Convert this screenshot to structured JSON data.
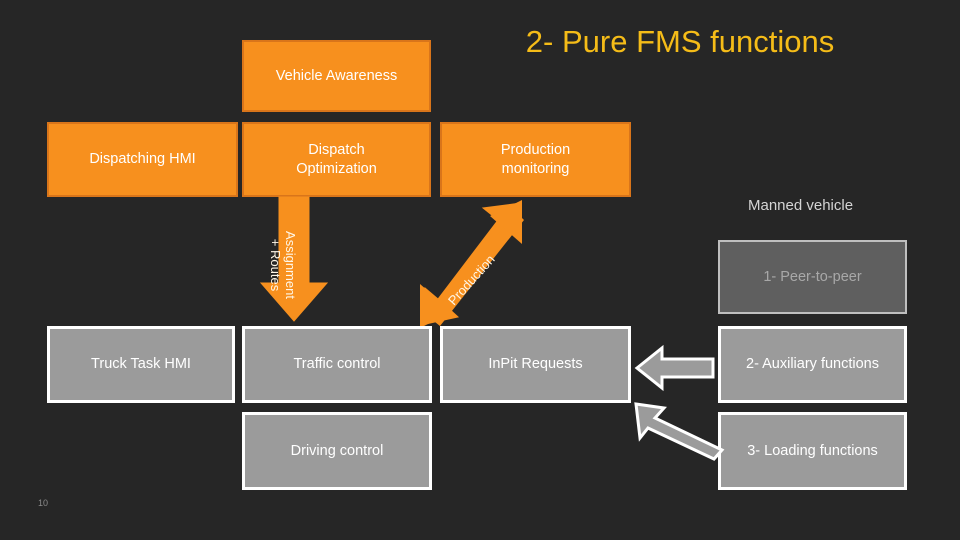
{
  "slide": {
    "title": "2- Pure FMS functions",
    "page_number": "10",
    "background_color": "#262626",
    "title_color": "#F5BC18"
  },
  "colors": {
    "fms_orange": "#F7901E",
    "fms_orange_border": "#D9751A",
    "vehicle_gray": "#9B9B9B",
    "inactive_gray": "#5F5F5F",
    "box_border_white": "#FFFFFF"
  },
  "fms_blocks": [
    {
      "id": "vehicle-awareness",
      "label": "Vehicle Awareness",
      "color": "#F7901E"
    },
    {
      "id": "dispatching-hmi",
      "label": "Dispatching HMI",
      "color": "#F7901E"
    },
    {
      "id": "dispatch-optimization",
      "label": "Dispatch\nOptimization",
      "line1": "Dispatch",
      "line2": "Optimization",
      "color": "#F7901E"
    },
    {
      "id": "production-monitoring",
      "label": "Production\nmonitoring",
      "line1": "Production",
      "line2": "monitoring",
      "color": "#F7901E"
    }
  ],
  "vehicle_blocks": [
    {
      "id": "truck-task-hmi",
      "label": "Truck Task HMI",
      "color": "#9B9B9B"
    },
    {
      "id": "traffic-control",
      "label": "Traffic control",
      "color": "#9B9B9B"
    },
    {
      "id": "inpit-requests",
      "label": "InPit Requests",
      "color": "#9B9B9B"
    },
    {
      "id": "driving-control",
      "label": "Driving control",
      "color": "#9B9B9B"
    }
  ],
  "right_column": {
    "group_label": "Manned vehicle",
    "blocks": [
      {
        "id": "peer-to-peer",
        "label": "1- Peer-to-peer",
        "state": "inactive",
        "color": "#5F5F5F"
      },
      {
        "id": "auxiliary-functions",
        "label": "2- Auxiliary functions",
        "state": "active",
        "color": "#9B9B9B"
      },
      {
        "id": "loading-functions",
        "label": "3- Loading functions",
        "state": "active",
        "color": "#9B9B9B"
      }
    ]
  },
  "arrows": [
    {
      "id": "assignment-routes-arrow",
      "label_line1": "Assignment",
      "label_line2": "+ Routes",
      "direction": "down",
      "color": "#F7901E",
      "from": "dispatch-optimization",
      "to": "traffic-control"
    },
    {
      "id": "production-arrow",
      "label": "Production",
      "direction": "up-right",
      "color": "#F7901E",
      "from": "inpit-requests",
      "to": "production-monitoring"
    },
    {
      "id": "auxiliary-to-inpit-arrow",
      "label": "",
      "direction": "left",
      "color": "#9B9B9B",
      "from": "auxiliary-functions",
      "to": "inpit-requests"
    },
    {
      "id": "loading-to-inpit-arrow",
      "label": "",
      "direction": "up-left",
      "color": "#9B9B9B",
      "from": "loading-functions",
      "to": "inpit-requests"
    }
  ]
}
